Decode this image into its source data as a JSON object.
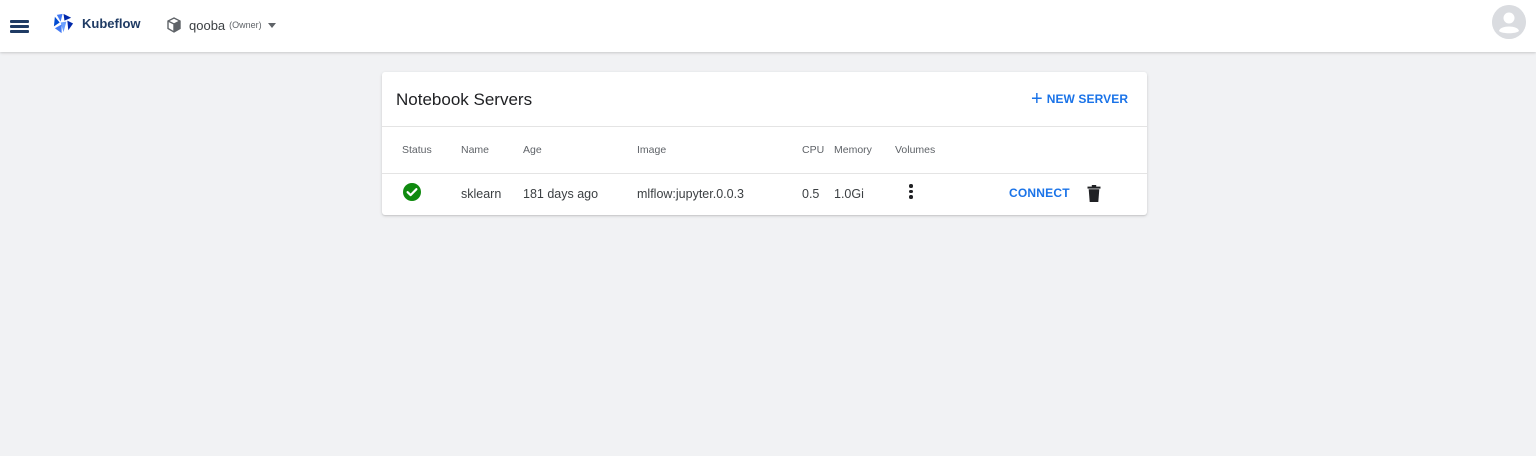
{
  "topbar": {
    "brand": "Kubeflow",
    "namespace": {
      "name": "qooba",
      "role": "(Owner)"
    },
    "icons": {
      "menu": "menu-icon",
      "logo": "kubeflow-logo-icon",
      "namespace": "cube-icon",
      "dropdown": "chevron-down-icon",
      "avatar": "account-circle-icon"
    }
  },
  "notebooks": {
    "title": "Notebook Servers",
    "new_server_label": "NEW SERVER",
    "columns": [
      "Status",
      "Name",
      "Age",
      "Image",
      "CPU",
      "Memory",
      "Volumes"
    ],
    "rows": [
      {
        "status": "running",
        "name": "sklearn",
        "age": "181 days ago",
        "image": "mlflow:jupyter.0.0.3",
        "cpu": "0.5",
        "memory": "1.0Gi",
        "connect_label": "CONNECT"
      }
    ]
  },
  "colors": {
    "accent": "#1a73e8",
    "brand": "#1f3b64",
    "status_ok": "#0f8a0f",
    "background": "#f1f2f4"
  }
}
